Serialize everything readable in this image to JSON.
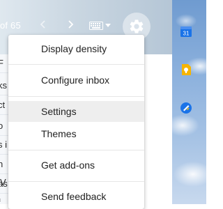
{
  "toolbar": {
    "pager_text": "of 65",
    "icons": [
      "chevron-left-icon",
      "chevron-right-icon",
      "keyboard-icon",
      "caret-down-icon",
      "gear-icon"
    ]
  },
  "mail_list": {
    "row_fragments": [
      "F",
      "ks",
      "ct",
      "o",
      "s i",
      "n V",
      "as",
      "f"
    ]
  },
  "side_panel": {
    "calendar_label": "31"
  },
  "settings_menu": {
    "items": [
      {
        "label": "Display density"
      },
      {
        "label": "Configure inbox"
      },
      {
        "label": "Settings"
      },
      {
        "label": "Themes"
      },
      {
        "label": "Get add-ons"
      },
      {
        "label": "Send feedback"
      }
    ],
    "highlighted_item": "Settings"
  },
  "colors": {
    "calendar_blue": "#1a73e8",
    "keep_yellow": "#f6b400",
    "tasks_blue": "#1a73e8",
    "menu_highlight": "#eeeeee"
  }
}
